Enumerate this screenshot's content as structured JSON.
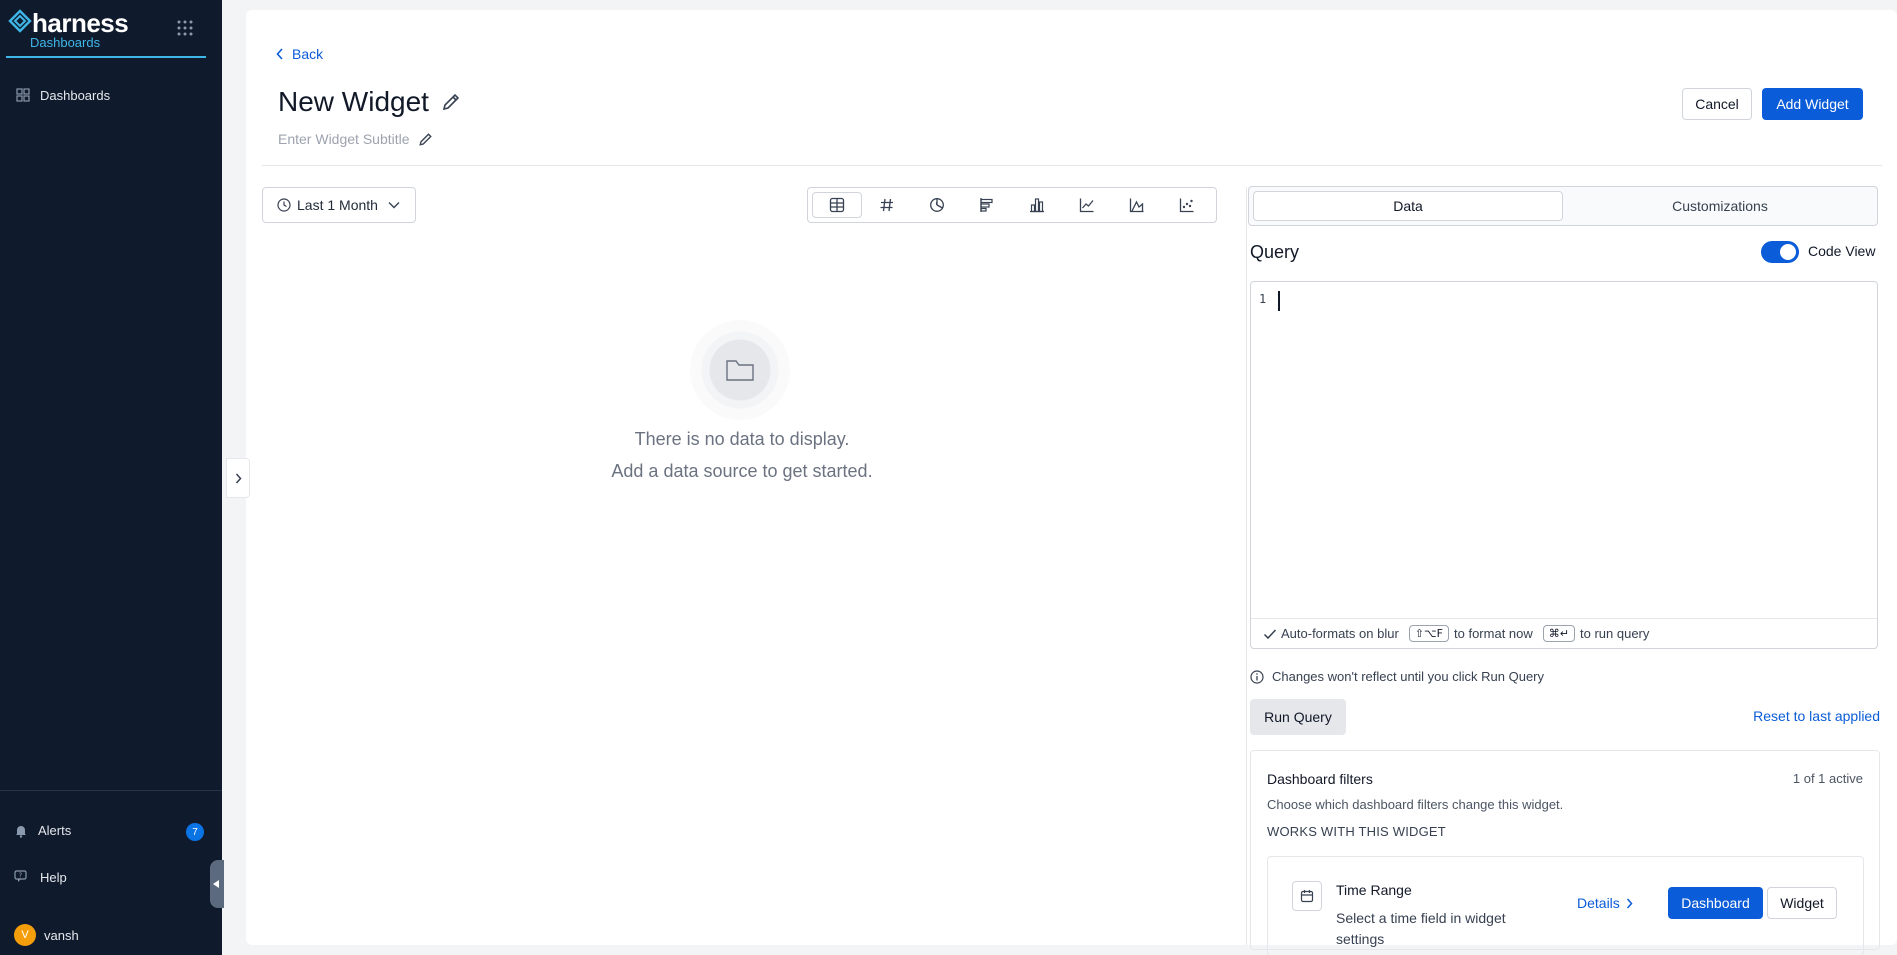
{
  "sidebar": {
    "brand_name": "harness",
    "module_name": "Dashboards",
    "nav_items": [
      {
        "label": "Dashboards",
        "icon": "dashboards-icon"
      }
    ],
    "bottom": {
      "alerts_label": "Alerts",
      "alerts_count": "7",
      "help_label": "Help",
      "user_initial": "V",
      "user_name": "vansh"
    }
  },
  "header": {
    "back_label": "Back",
    "widget_title": "New Widget",
    "subtitle_placeholder": "Enter Widget Subtitle",
    "cancel_label": "Cancel",
    "add_widget_label": "Add Widget"
  },
  "left_panel": {
    "time_range_label": "Last 1 Month",
    "viz_types": [
      "table-icon",
      "number-icon",
      "pie-icon",
      "horizontal-bar-icon",
      "vertical-bar-icon",
      "line-chart-icon",
      "area-chart-icon",
      "scatter-icon"
    ],
    "active_viz": "table-icon",
    "empty_line1": "There is no data to display.",
    "empty_line2": "Add a data source to get started."
  },
  "right_panel": {
    "tabs": [
      "Data",
      "Customizations"
    ],
    "active_tab": "Data",
    "query_label": "Query",
    "code_view_label": "Code View",
    "code_view_on": true,
    "editor": {
      "line_number": "1",
      "footer_autoformat": "Auto-formats on blur",
      "format_keys": "⇧⌥F",
      "format_text": "to format now",
      "run_keys": "⌘↵",
      "run_text": "to run query"
    },
    "info_text": "Changes won't reflect until you click Run Query",
    "run_query_label": "Run Query",
    "reset_label": "Reset to last applied",
    "filters": {
      "title": "Dashboard filters",
      "count": "1 of 1 active",
      "description": "Choose which dashboard filters change this widget.",
      "section_label": "WORKS WITH THIS WIDGET",
      "items": [
        {
          "name": "Time Range",
          "description": "Select a time field in widget settings",
          "details_label": "Details",
          "dashboard_label": "Dashboard",
          "widget_label": "Widget"
        }
      ]
    }
  },
  "colors": {
    "sidebar_bg": "#0f1b2d",
    "accent": "#3fb6e8",
    "primary": "#0b5cd8"
  }
}
